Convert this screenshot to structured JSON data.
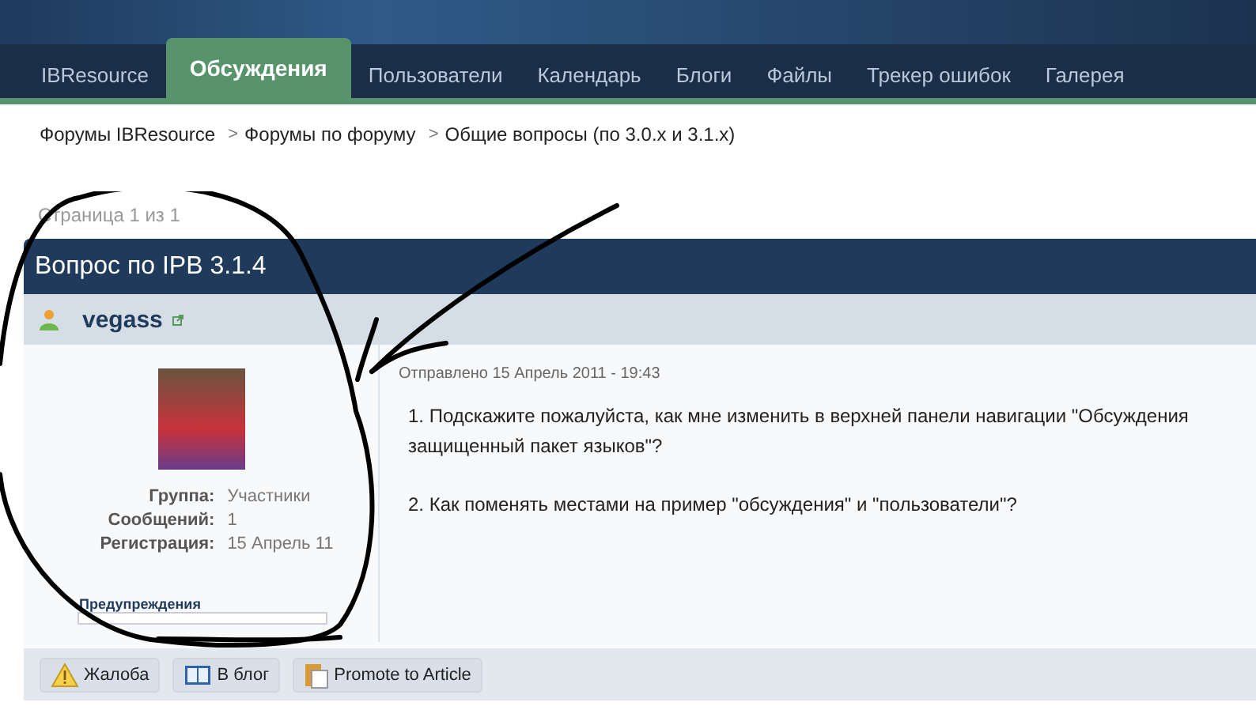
{
  "nav": {
    "tabs": [
      {
        "label": "IBResource",
        "selected": false
      },
      {
        "label": "Обсуждения",
        "selected": true
      },
      {
        "label": "Пользователи",
        "selected": false
      },
      {
        "label": "Календарь",
        "selected": false
      },
      {
        "label": "Блоги",
        "selected": false
      },
      {
        "label": "Файлы",
        "selected": false
      },
      {
        "label": "Трекер ошибок",
        "selected": false
      },
      {
        "label": "Галерея",
        "selected": false
      }
    ]
  },
  "breadcrumb": [
    {
      "label": "Форумы IBResource"
    },
    {
      "separator": ">",
      "label": "Форумы по форуму"
    },
    {
      "separator": ">",
      "label": "Общие вопросы (по 3.0.x и 3.1.x)"
    }
  ],
  "pagination": "Страница 1 из 1",
  "topic": {
    "title": "Вопрос по IPB 3.1.4"
  },
  "post": {
    "author": "vegass",
    "author_info": [
      {
        "label": "Группа:",
        "value": "Участники"
      },
      {
        "label": "Сообщений:",
        "value": "1"
      },
      {
        "label": "Регистрация:",
        "value": "15 Апрель 11"
      }
    ],
    "warnings_label": "Предупреждения",
    "posted": "Отправлено 15 Апрель 2011 - 19:43",
    "paragraphs": [
      [
        "1. Подскажите пожалуйста, как мне изменить в верхней панели навигации \"Обсуждения",
        "защищенный пакет языков\"?"
      ],
      [
        "2. Как поменять местами на пример \"обсуждения\" и \"пользователи\"?"
      ]
    ],
    "actions": [
      {
        "kind": "report",
        "label": "Жалоба"
      },
      {
        "kind": "blog",
        "label": "В блог"
      },
      {
        "kind": "promote",
        "label": "Promote to Article"
      }
    ]
  }
}
